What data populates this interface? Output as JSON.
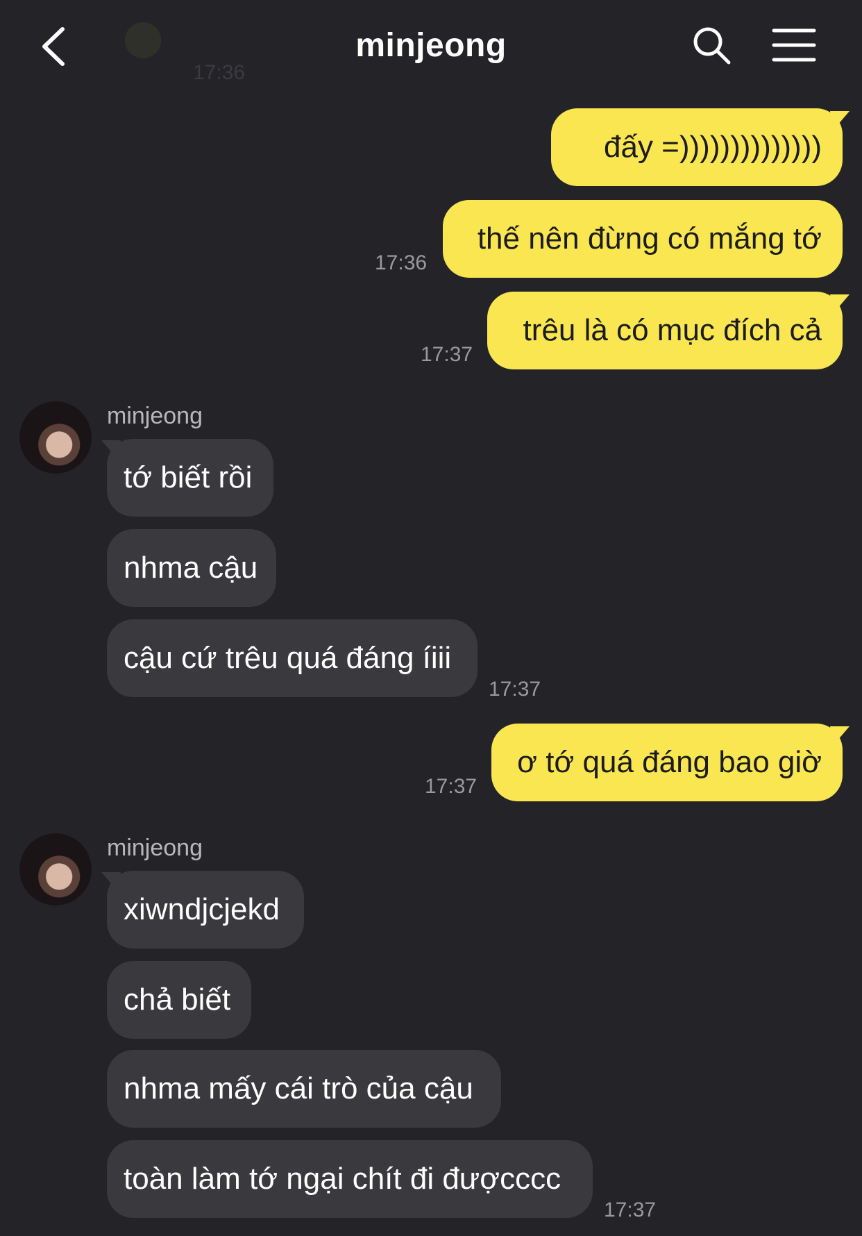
{
  "header": {
    "title": "minjeong",
    "ghost_time": "17:36"
  },
  "colors": {
    "background": "#242428",
    "my_bubble": "#f9e651",
    "their_bubble": "#3a3a3e"
  },
  "messages": {
    "m1": {
      "text": "đấy =))))))))))))))"
    },
    "m2": {
      "text": "thế nên đừng có mắng tớ",
      "time": "17:36"
    },
    "m3": {
      "text": "trêu là có mục đích cả",
      "time": "17:37"
    },
    "g1": {
      "sender": "minjeong",
      "m1": "tớ biết rồi",
      "m2": "nhma cậu",
      "m3": "cậu cứ trêu quá đáng íiii",
      "time": "17:37"
    },
    "m4": {
      "text": "ơ tớ quá đáng bao giờ",
      "time": "17:37"
    },
    "g2": {
      "sender": "minjeong",
      "m1": "xiwndjcjekd",
      "m2": "chả biết",
      "m3": "nhma mấy cái trò của cậu",
      "m4": "toàn làm tớ ngại chít đi đượcccc",
      "time": "17:37"
    }
  }
}
